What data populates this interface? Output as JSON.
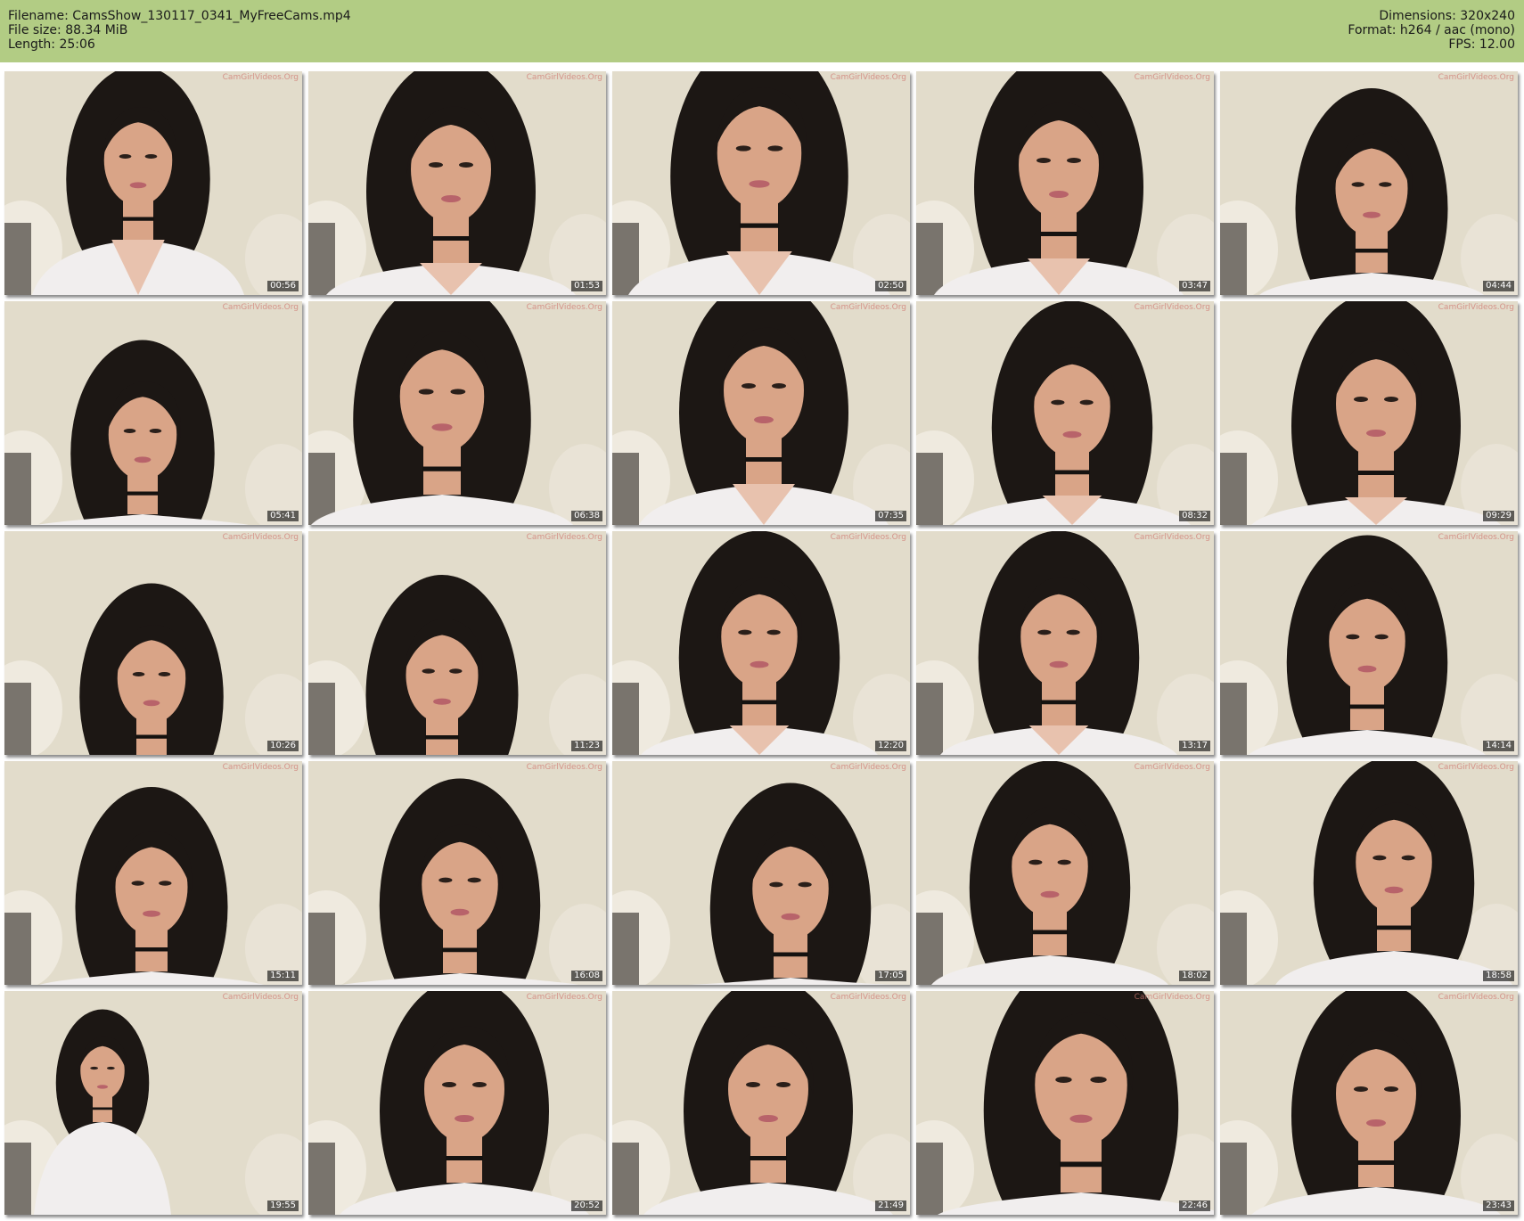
{
  "header": {
    "filename": "Filename: CamsShow_130117_0341_MyFreeCams.mp4",
    "file_size": "File size: 88.34 MiB",
    "length": "Length: 25:06",
    "dimensions": "Dimensions: 320x240",
    "format": "Format: h264 / aac (mono)",
    "fps": "FPS: 12.00"
  },
  "watermark": "CamGirlVideos.Org",
  "thumbnails": [
    {
      "timestamp": "00:56"
    },
    {
      "timestamp": "01:53"
    },
    {
      "timestamp": "02:50"
    },
    {
      "timestamp": "03:47"
    },
    {
      "timestamp": "04:44"
    },
    {
      "timestamp": "05:41"
    },
    {
      "timestamp": "06:38"
    },
    {
      "timestamp": "07:35"
    },
    {
      "timestamp": "08:32"
    },
    {
      "timestamp": "09:29"
    },
    {
      "timestamp": "10:26"
    },
    {
      "timestamp": "11:23"
    },
    {
      "timestamp": "12:20"
    },
    {
      "timestamp": "13:17"
    },
    {
      "timestamp": "14:14"
    },
    {
      "timestamp": "15:11"
    },
    {
      "timestamp": "16:08"
    },
    {
      "timestamp": "17:05"
    },
    {
      "timestamp": "18:02"
    },
    {
      "timestamp": "18:58"
    },
    {
      "timestamp": "19:55"
    },
    {
      "timestamp": "20:52"
    },
    {
      "timestamp": "21:49"
    },
    {
      "timestamp": "22:46"
    },
    {
      "timestamp": "23:43"
    }
  ],
  "colors": {
    "header_bg": "#b2cc84",
    "wall": "#e2dccb",
    "hair": "#1c1714",
    "skin": "#d9a487",
    "robe": "#f1eeee"
  }
}
